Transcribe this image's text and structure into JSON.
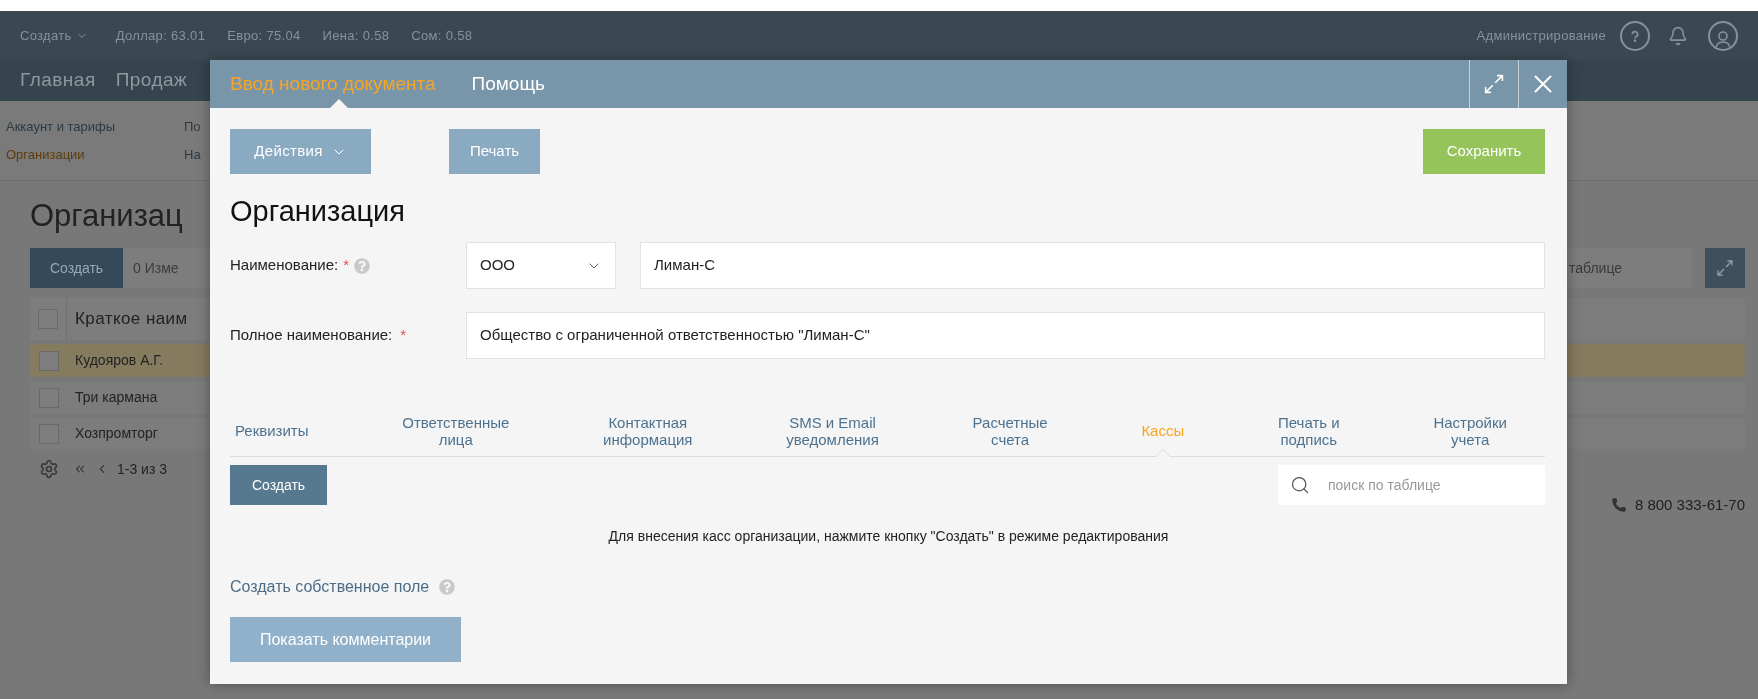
{
  "top_bar": {
    "create_menu": "Создать",
    "rates": [
      "Доллар: 63.01",
      "Евро: 75.04",
      "Иена: 0.58",
      "Сом: 0.58"
    ],
    "admin_link": "Администрирование"
  },
  "main_nav": [
    "Главная",
    "Продаж"
  ],
  "sub_nav": [
    [
      {
        "label": "Аккаунт и тарифы",
        "selected": false
      },
      {
        "label": "По",
        "selected": false
      }
    ],
    [
      {
        "label": "Организации",
        "selected": true
      },
      {
        "label": "На",
        "selected": false
      }
    ]
  ],
  "background_page": {
    "title": "Организац",
    "create_button": "Создать",
    "edit_button": "0 Изме",
    "search_placeholder": "таблице",
    "table": {
      "header": "Краткое наим",
      "header_checked": false,
      "rows": [
        {
          "name": "Кудояров А.Г.",
          "selected": true,
          "checked": false
        },
        {
          "name": "Три кармана",
          "selected": false,
          "checked": false
        },
        {
          "name": "Хозпромторг",
          "selected": false,
          "checked": false
        }
      ]
    },
    "pagination": "1-3 из 3",
    "phone": "8 800 333-61-70"
  },
  "dialog": {
    "tabs": [
      {
        "label": "Ввод нового документа",
        "selected": true
      },
      {
        "label": "Помощь",
        "selected": false
      }
    ],
    "actions_button": "Действия",
    "print_button": "Печать",
    "save_button": "Сохранить",
    "heading": "Организация",
    "name_field": {
      "label": "Наименование:",
      "required_mark": "*",
      "help": true,
      "form": "ООО",
      "value": "Лиман-С"
    },
    "full_name_field": {
      "label": "Полное наименование:",
      "required_mark": "*",
      "value": "Общество с ограниченной ответственностью \"Лиман-С\""
    },
    "sections": [
      {
        "label": "Реквизиты",
        "selected": false
      },
      {
        "label": "Ответственные\nлица",
        "selected": false
      },
      {
        "label": "Контактная\nинформация",
        "selected": false
      },
      {
        "label": "SMS и Email\nуведомления",
        "selected": false
      },
      {
        "label": "Расчетные\nсчета",
        "selected": false
      },
      {
        "label": "Кассы",
        "selected": true
      },
      {
        "label": "Печать и\nподпись",
        "selected": false
      },
      {
        "label": "Настройки\nучета",
        "selected": false
      }
    ],
    "create_button": "Создать",
    "search_placeholder": "поиск по таблице",
    "empty_message": "Для внесения касс организации, нажмите кнопку \"Создать\" в режиме редактирования",
    "custom_field_link": "Создать собственное поле",
    "custom_field_help": true,
    "comments_button": "Показать комментарии"
  }
}
